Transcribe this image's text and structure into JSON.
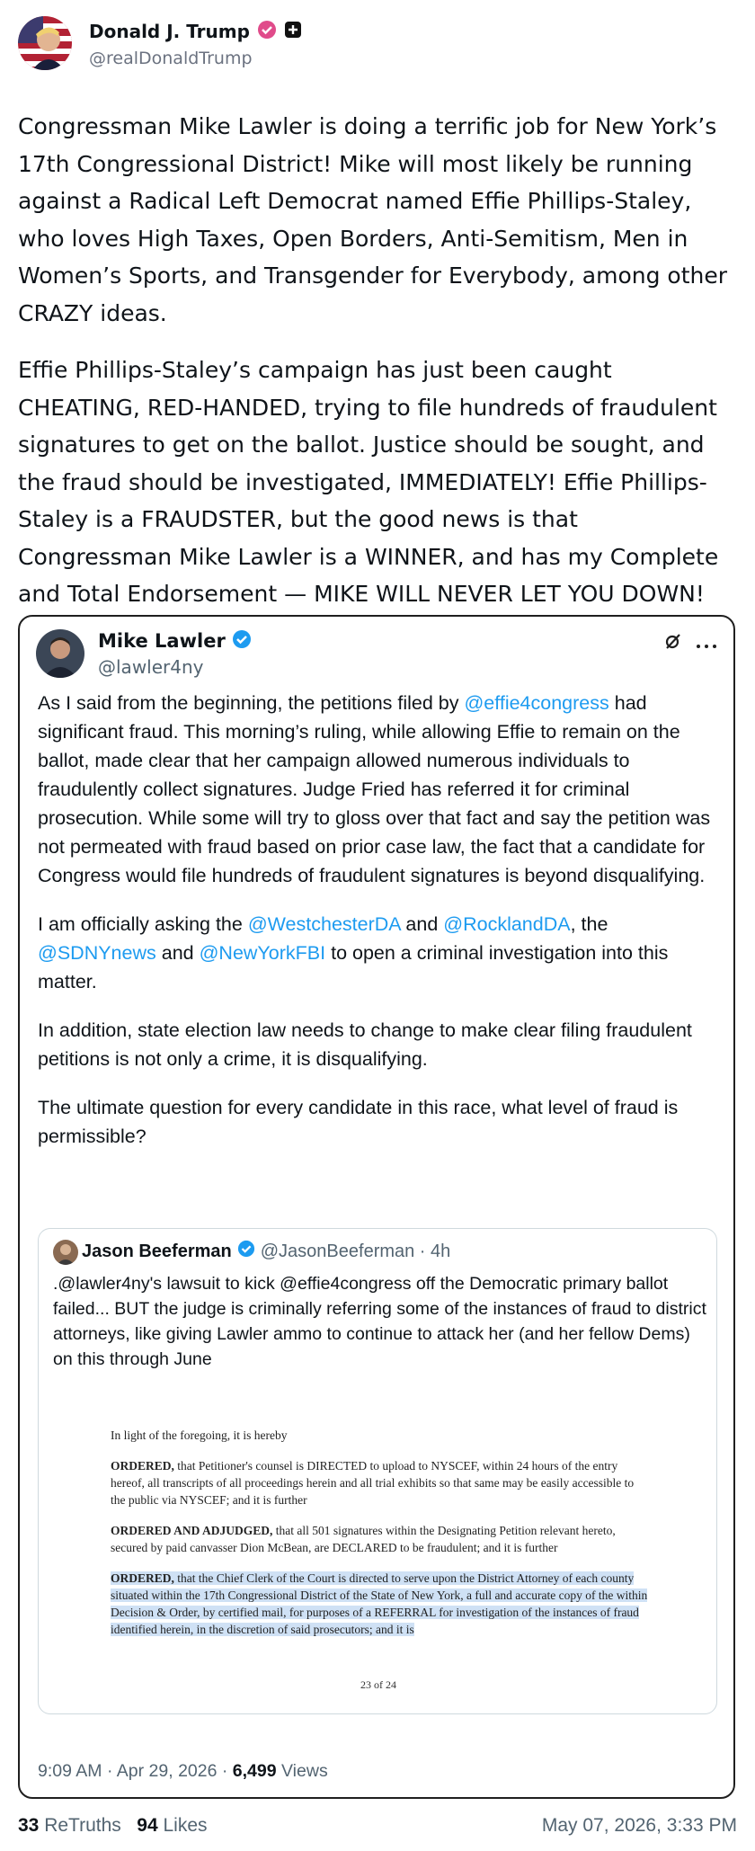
{
  "author": {
    "name": "Donald J. Trump",
    "handle": "@realDonaldTrump",
    "verified_color": "#e04b8a"
  },
  "post": {
    "paragraph_1": "Congressman Mike Lawler is doing a terrific job for New York’s 17th Congressional District! Mike will most likely be running against a Radical Left Democrat named Effie Phillips-Staley, who loves High Taxes, Open Borders, Anti-Semitism, Men in Women’s Sports, and Transgender for Everybody, among other CRAZY ideas.",
    "paragraph_2": "Effie Phillips-Staley’s campaign has just been caught CHEATING, RED-HANDED, trying to file hundreds of fraudulent signatures to get on the ballot. Justice should be sought, and the fraud should be investigated, IMMEDIATELY! Effie Phillips-Staley is a FRAUDSTER, but the good news is that Congressman Mike Lawler is a WINNER, and has my Complete and Total Endorsement — MIKE WILL NEVER LET YOU DOWN!"
  },
  "quoted": {
    "name": "Mike Lawler",
    "handle": "@lawler4ny",
    "p1_a": "As I said from the beginning, the petitions filed by ",
    "p1_mention": "@effie4congress",
    "p1_b": " had significant fraud. This morning’s ruling, while allowing Effie to remain on the ballot, made clear that her campaign allowed numerous individuals to fraudulently collect signatures. Judge Fried has referred it for criminal prosecution. While some will try to gloss over that fact and say the petition was not permeated with fraud based on prior case law, the fact that a candidate for Congress would file hundreds of fraudulent signatures is beyond disqualifying.",
    "p2_a": "I am officially asking the ",
    "p2_m1": "@WestchesterDA",
    "p2_b": " and ",
    "p2_m2": "@RocklandDA",
    "p2_c": ", the ",
    "p2_m3": "@SDNYnews",
    "p2_d": " and ",
    "p2_m4": "@NewYorkFBI",
    "p2_e": " to open a criminal investigation into this matter.",
    "p3": "In addition, state election law needs to change to make clear filing fraudulent petitions is not only a crime, it is disqualifying.",
    "p4": "The ultimate question for every candidate in this race, what level of fraud is permissible?",
    "time": "9:09 AM · Apr 29, 2026 · ",
    "views_count": "6,499",
    "views_label": " Views",
    "inner": {
      "name": "Jason Beeferman",
      "handle": "@JasonBeeferman · 4h",
      "text": ".@lawler4ny's lawsuit to kick @effie4congress off the Democratic primary ballot failed... BUT the judge is criminally referring some of the instances of fraud to district attorneys, like giving Lawler ammo to continue to attack her (and her fellow Dems) on this through June",
      "doc_intro": "In light of the foregoing, it is hereby",
      "doc_o1_label": "ORDERED,",
      "doc_o1": " that Petitioner's counsel is DIRECTED to upload to NYSCEF, within 24 hours of the entry hereof, all transcripts of all proceedings herein and all trial exhibits so that same may be easily accessible to the public via NYSCEF; and it is further",
      "doc_o2_label": "ORDERED AND ADJUDGED,",
      "doc_o2": " that all 501 signatures within the Designating Petition relevant hereto, secured by paid canvasser Dion McBean, are DECLARED to be fraudulent; and it is further",
      "doc_o3_label": "ORDERED,",
      "doc_o3": " that the Chief Clerk of the Court is directed to serve upon the District Attorney of each county situated within the 17th Congressional District of the State of New York, a full and accurate copy of the within Decision & Order, by certified mail, for purposes of a REFERRAL for investigation of the instances of fraud identified herein, in the discretion of said prosecutors; and it is",
      "doc_page": "23 of 24"
    }
  },
  "stats": {
    "retruths_count": "33",
    "retruths_label": " ReTruths",
    "likes_count": "94",
    "likes_label": " Likes",
    "date": "May 07, 2026, 3:33 PM"
  },
  "colors": {
    "link": "#1d9bf0",
    "muted": "#536471",
    "highlight": "#cfe1f5"
  }
}
